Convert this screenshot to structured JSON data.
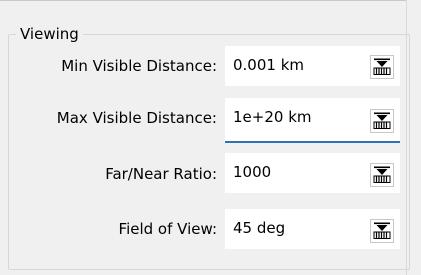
{
  "group": {
    "title": "Viewing"
  },
  "rows": [
    {
      "label": "Min Visible Distance:",
      "value": "0.001 km",
      "icon": "units-picker-icon"
    },
    {
      "label": "Max Visible Distance:",
      "value": "1e+20 km",
      "icon": "units-picker-icon",
      "focused": true
    },
    {
      "label": "Far/Near Ratio:",
      "value": "1000",
      "icon": "units-picker-icon"
    },
    {
      "label": "Field of View:",
      "value": "45 deg",
      "icon": "units-picker-icon"
    }
  ],
  "colors": {
    "focus_underline": "#2d72b8",
    "window_bg": "#f0f0f0"
  }
}
